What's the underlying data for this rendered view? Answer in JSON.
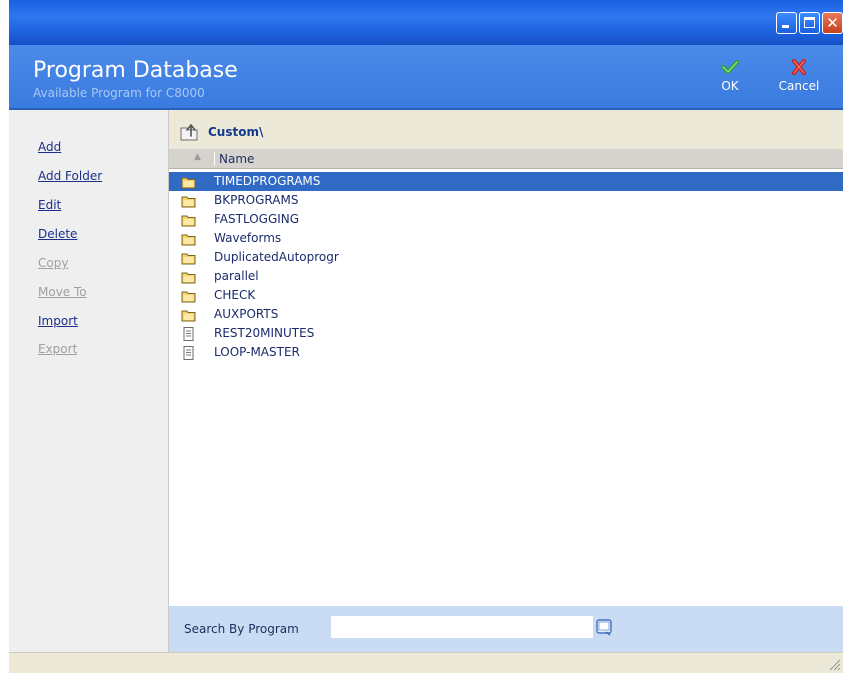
{
  "window": {
    "buttons": {
      "minimize": "minimize",
      "maximize": "maximize",
      "close": "close"
    }
  },
  "header": {
    "title": "Program Database",
    "subtitle": "Available Program for C8000",
    "ok_label": "OK",
    "cancel_label": "Cancel",
    "ok_icon": "checkmark-icon",
    "cancel_icon": "x-icon"
  },
  "sidebar": {
    "items": [
      {
        "label": "Add",
        "enabled": true
      },
      {
        "label": "Add Folder",
        "enabled": true
      },
      {
        "label": "Edit",
        "enabled": true
      },
      {
        "label": "Delete",
        "enabled": true
      },
      {
        "label": "Copy",
        "enabled": false
      },
      {
        "label": "Move To",
        "enabled": false
      },
      {
        "label": "Import",
        "enabled": true
      },
      {
        "label": "Export",
        "enabled": false
      }
    ]
  },
  "path": {
    "current": "Custom\\",
    "icon": "folder-up-icon"
  },
  "list": {
    "column_name": "Name",
    "sort_indicator": "▲",
    "rows": [
      {
        "name": "TIMEDPROGRAMS",
        "type": "folder",
        "selected": true
      },
      {
        "name": "BKPROGRAMS",
        "type": "folder",
        "selected": false
      },
      {
        "name": "FASTLOGGING",
        "type": "folder",
        "selected": false
      },
      {
        "name": "Waveforms",
        "type": "folder",
        "selected": false
      },
      {
        "name": "DuplicatedAutoprogr",
        "type": "folder",
        "selected": false
      },
      {
        "name": "parallel",
        "type": "folder",
        "selected": false
      },
      {
        "name": "CHECK",
        "type": "folder",
        "selected": false
      },
      {
        "name": "AUXPORTS",
        "type": "folder",
        "selected": false
      },
      {
        "name": "REST20MINUTES",
        "type": "file",
        "selected": false
      },
      {
        "name": "LOOP-MASTER",
        "type": "file",
        "selected": false
      }
    ]
  },
  "search": {
    "label": "Search By Program",
    "value": "",
    "placeholder": ""
  },
  "colors": {
    "title_bar": "#1a5fe0",
    "header": "#4b8ae8",
    "selection": "#316ac5",
    "link": "#1c2f8a",
    "disabled_link": "#a0a0a0",
    "search_panel": "#c9dcf3"
  }
}
